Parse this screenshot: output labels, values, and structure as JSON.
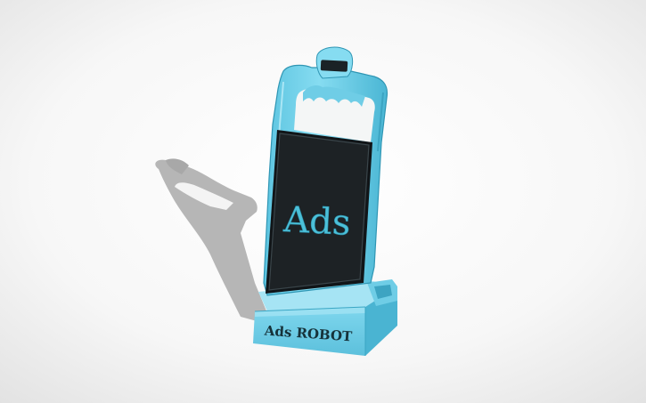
{
  "model": {
    "screen_text": "Ads",
    "base_text": "Ads ROBOT"
  },
  "colors": {
    "background_light": "#ffffff",
    "background_dark": "#e6e6e6",
    "shadow": "#b4b4b4",
    "body": "#78d4ec",
    "body_dark": "#3aa6c4",
    "body_light": "#b4eaf7",
    "screen": "#1d2225",
    "screen_text": "#4cc0d8",
    "base_text": "#16323a"
  }
}
